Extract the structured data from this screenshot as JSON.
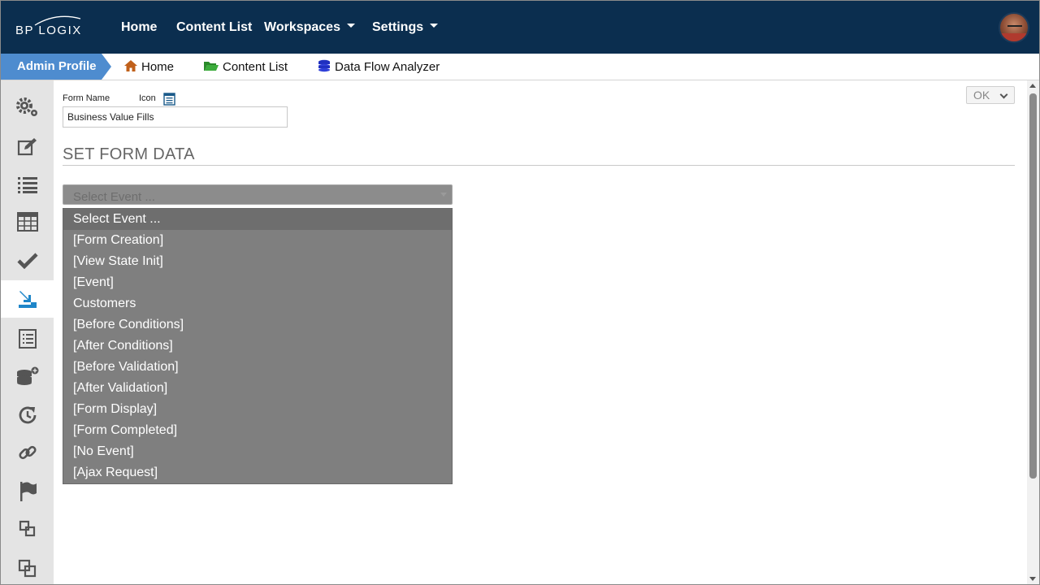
{
  "brand": {
    "logo_text": "BP LOGIX",
    "accent": "#0b2e4f",
    "crumb_accent": "#4e8ccf"
  },
  "topnav": {
    "home": "Home",
    "content_list": "Content List",
    "workspaces": "Workspaces",
    "settings": "Settings"
  },
  "breadcrumb": {
    "admin": "Admin Profile",
    "home": "Home",
    "content_list": "Content List",
    "data_flow": "Data Flow Analyzer"
  },
  "sidebar": {
    "items": [
      {
        "icon": "gears-icon"
      },
      {
        "icon": "edit-icon"
      },
      {
        "icon": "list-icon"
      },
      {
        "icon": "table-icon"
      },
      {
        "icon": "check-icon"
      },
      {
        "icon": "set-form-data-icon",
        "active": true
      },
      {
        "icon": "document-list-icon"
      },
      {
        "icon": "database-add-icon"
      },
      {
        "icon": "refresh-clock-icon"
      },
      {
        "icon": "link-icon"
      },
      {
        "icon": "flag-icon"
      },
      {
        "icon": "forward-layers-icon"
      },
      {
        "icon": "copy-layers-icon"
      }
    ]
  },
  "form": {
    "name_label": "Form Name",
    "icon_label": "Icon",
    "name_value": "Business Value Fills",
    "section_title": "SET FORM DATA",
    "ok_label": "OK"
  },
  "event_select": {
    "selected": "Select Event ...",
    "options": [
      "Select Event ...",
      "[Form Creation]",
      "[View State Init]",
      "[Event]",
      "Customers",
      "[Before Conditions]",
      "[After Conditions]",
      "[Before Validation]",
      "[After Validation]",
      "[Form Display]",
      "[Form Completed]",
      "[No Event]",
      "[Ajax Request]"
    ]
  }
}
